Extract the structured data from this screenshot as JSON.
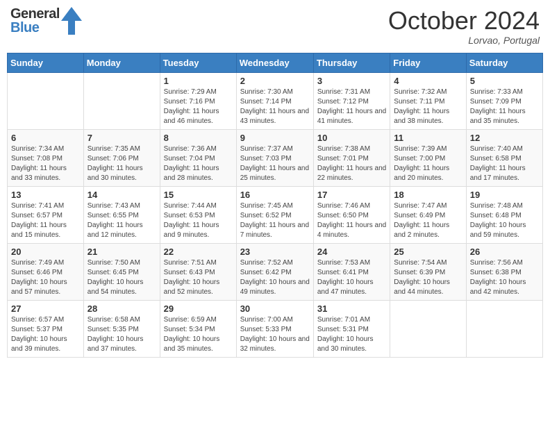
{
  "header": {
    "logo_general": "General",
    "logo_blue": "Blue",
    "month_title": "October 2024",
    "location": "Lorvao, Portugal"
  },
  "days_of_week": [
    "Sunday",
    "Monday",
    "Tuesday",
    "Wednesday",
    "Thursday",
    "Friday",
    "Saturday"
  ],
  "weeks": [
    [
      {
        "day": "",
        "sunrise": "",
        "sunset": "",
        "daylight": ""
      },
      {
        "day": "",
        "sunrise": "",
        "sunset": "",
        "daylight": ""
      },
      {
        "day": "1",
        "sunrise": "Sunrise: 7:29 AM",
        "sunset": "Sunset: 7:16 PM",
        "daylight": "Daylight: 11 hours and 46 minutes."
      },
      {
        "day": "2",
        "sunrise": "Sunrise: 7:30 AM",
        "sunset": "Sunset: 7:14 PM",
        "daylight": "Daylight: 11 hours and 43 minutes."
      },
      {
        "day": "3",
        "sunrise": "Sunrise: 7:31 AM",
        "sunset": "Sunset: 7:12 PM",
        "daylight": "Daylight: 11 hours and 41 minutes."
      },
      {
        "day": "4",
        "sunrise": "Sunrise: 7:32 AM",
        "sunset": "Sunset: 7:11 PM",
        "daylight": "Daylight: 11 hours and 38 minutes."
      },
      {
        "day": "5",
        "sunrise": "Sunrise: 7:33 AM",
        "sunset": "Sunset: 7:09 PM",
        "daylight": "Daylight: 11 hours and 35 minutes."
      }
    ],
    [
      {
        "day": "6",
        "sunrise": "Sunrise: 7:34 AM",
        "sunset": "Sunset: 7:08 PM",
        "daylight": "Daylight: 11 hours and 33 minutes."
      },
      {
        "day": "7",
        "sunrise": "Sunrise: 7:35 AM",
        "sunset": "Sunset: 7:06 PM",
        "daylight": "Daylight: 11 hours and 30 minutes."
      },
      {
        "day": "8",
        "sunrise": "Sunrise: 7:36 AM",
        "sunset": "Sunset: 7:04 PM",
        "daylight": "Daylight: 11 hours and 28 minutes."
      },
      {
        "day": "9",
        "sunrise": "Sunrise: 7:37 AM",
        "sunset": "Sunset: 7:03 PM",
        "daylight": "Daylight: 11 hours and 25 minutes."
      },
      {
        "day": "10",
        "sunrise": "Sunrise: 7:38 AM",
        "sunset": "Sunset: 7:01 PM",
        "daylight": "Daylight: 11 hours and 22 minutes."
      },
      {
        "day": "11",
        "sunrise": "Sunrise: 7:39 AM",
        "sunset": "Sunset: 7:00 PM",
        "daylight": "Daylight: 11 hours and 20 minutes."
      },
      {
        "day": "12",
        "sunrise": "Sunrise: 7:40 AM",
        "sunset": "Sunset: 6:58 PM",
        "daylight": "Daylight: 11 hours and 17 minutes."
      }
    ],
    [
      {
        "day": "13",
        "sunrise": "Sunrise: 7:41 AM",
        "sunset": "Sunset: 6:57 PM",
        "daylight": "Daylight: 11 hours and 15 minutes."
      },
      {
        "day": "14",
        "sunrise": "Sunrise: 7:43 AM",
        "sunset": "Sunset: 6:55 PM",
        "daylight": "Daylight: 11 hours and 12 minutes."
      },
      {
        "day": "15",
        "sunrise": "Sunrise: 7:44 AM",
        "sunset": "Sunset: 6:53 PM",
        "daylight": "Daylight: 11 hours and 9 minutes."
      },
      {
        "day": "16",
        "sunrise": "Sunrise: 7:45 AM",
        "sunset": "Sunset: 6:52 PM",
        "daylight": "Daylight: 11 hours and 7 minutes."
      },
      {
        "day": "17",
        "sunrise": "Sunrise: 7:46 AM",
        "sunset": "Sunset: 6:50 PM",
        "daylight": "Daylight: 11 hours and 4 minutes."
      },
      {
        "day": "18",
        "sunrise": "Sunrise: 7:47 AM",
        "sunset": "Sunset: 6:49 PM",
        "daylight": "Daylight: 11 hours and 2 minutes."
      },
      {
        "day": "19",
        "sunrise": "Sunrise: 7:48 AM",
        "sunset": "Sunset: 6:48 PM",
        "daylight": "Daylight: 10 hours and 59 minutes."
      }
    ],
    [
      {
        "day": "20",
        "sunrise": "Sunrise: 7:49 AM",
        "sunset": "Sunset: 6:46 PM",
        "daylight": "Daylight: 10 hours and 57 minutes."
      },
      {
        "day": "21",
        "sunrise": "Sunrise: 7:50 AM",
        "sunset": "Sunset: 6:45 PM",
        "daylight": "Daylight: 10 hours and 54 minutes."
      },
      {
        "day": "22",
        "sunrise": "Sunrise: 7:51 AM",
        "sunset": "Sunset: 6:43 PM",
        "daylight": "Daylight: 10 hours and 52 minutes."
      },
      {
        "day": "23",
        "sunrise": "Sunrise: 7:52 AM",
        "sunset": "Sunset: 6:42 PM",
        "daylight": "Daylight: 10 hours and 49 minutes."
      },
      {
        "day": "24",
        "sunrise": "Sunrise: 7:53 AM",
        "sunset": "Sunset: 6:41 PM",
        "daylight": "Daylight: 10 hours and 47 minutes."
      },
      {
        "day": "25",
        "sunrise": "Sunrise: 7:54 AM",
        "sunset": "Sunset: 6:39 PM",
        "daylight": "Daylight: 10 hours and 44 minutes."
      },
      {
        "day": "26",
        "sunrise": "Sunrise: 7:56 AM",
        "sunset": "Sunset: 6:38 PM",
        "daylight": "Daylight: 10 hours and 42 minutes."
      }
    ],
    [
      {
        "day": "27",
        "sunrise": "Sunrise: 6:57 AM",
        "sunset": "Sunset: 5:37 PM",
        "daylight": "Daylight: 10 hours and 39 minutes."
      },
      {
        "day": "28",
        "sunrise": "Sunrise: 6:58 AM",
        "sunset": "Sunset: 5:35 PM",
        "daylight": "Daylight: 10 hours and 37 minutes."
      },
      {
        "day": "29",
        "sunrise": "Sunrise: 6:59 AM",
        "sunset": "Sunset: 5:34 PM",
        "daylight": "Daylight: 10 hours and 35 minutes."
      },
      {
        "day": "30",
        "sunrise": "Sunrise: 7:00 AM",
        "sunset": "Sunset: 5:33 PM",
        "daylight": "Daylight: 10 hours and 32 minutes."
      },
      {
        "day": "31",
        "sunrise": "Sunrise: 7:01 AM",
        "sunset": "Sunset: 5:31 PM",
        "daylight": "Daylight: 10 hours and 30 minutes."
      },
      {
        "day": "",
        "sunrise": "",
        "sunset": "",
        "daylight": ""
      },
      {
        "day": "",
        "sunrise": "",
        "sunset": "",
        "daylight": ""
      }
    ]
  ]
}
